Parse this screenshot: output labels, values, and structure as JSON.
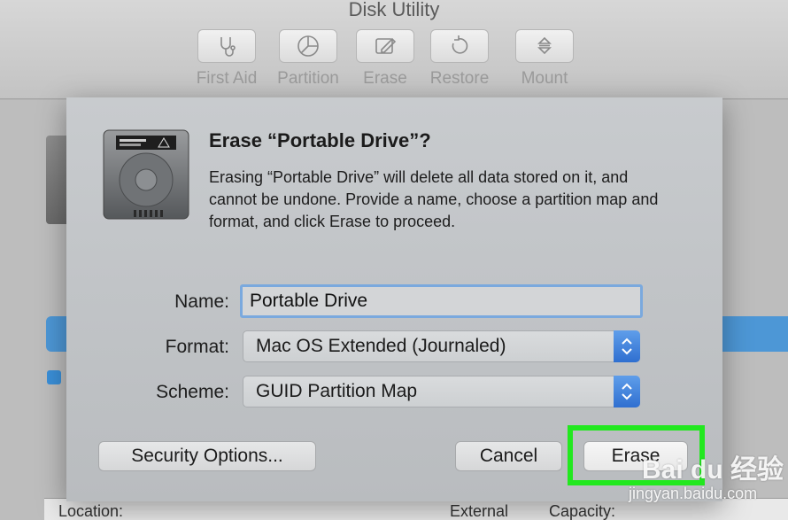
{
  "window": {
    "title": "Disk Utility"
  },
  "toolbar": {
    "items": [
      {
        "label": "First Aid",
        "icon": "stethoscope-icon"
      },
      {
        "label": "Partition",
        "icon": "partition-pie-icon"
      },
      {
        "label": "Erase",
        "icon": "erase-icon"
      },
      {
        "label": "Restore",
        "icon": "restore-icon"
      },
      {
        "label": "Mount",
        "icon": "mount-icon"
      }
    ]
  },
  "dialog": {
    "title": "Erase “Portable Drive”?",
    "message": "Erasing “Portable Drive” will delete all data stored on it, and cannot be undone. Provide a name, choose a partition map and format, and click Erase to proceed.",
    "fields": {
      "name": {
        "label": "Name:",
        "value": "Portable Drive"
      },
      "format": {
        "label": "Format:",
        "value": "Mac OS Extended (Journaled)"
      },
      "scheme": {
        "label": "Scheme:",
        "value": "GUID Partition Map"
      }
    },
    "buttons": {
      "security": "Security Options...",
      "cancel": "Cancel",
      "erase": "Erase"
    }
  },
  "background": {
    "columns": [
      "Location:",
      "External",
      "Capacity:"
    ]
  },
  "watermark": {
    "logo": "Bai du 经验",
    "url": "jingyan.baidu.com"
  },
  "colors": {
    "accent": "#3a82df",
    "highlight": "#22e81f"
  }
}
